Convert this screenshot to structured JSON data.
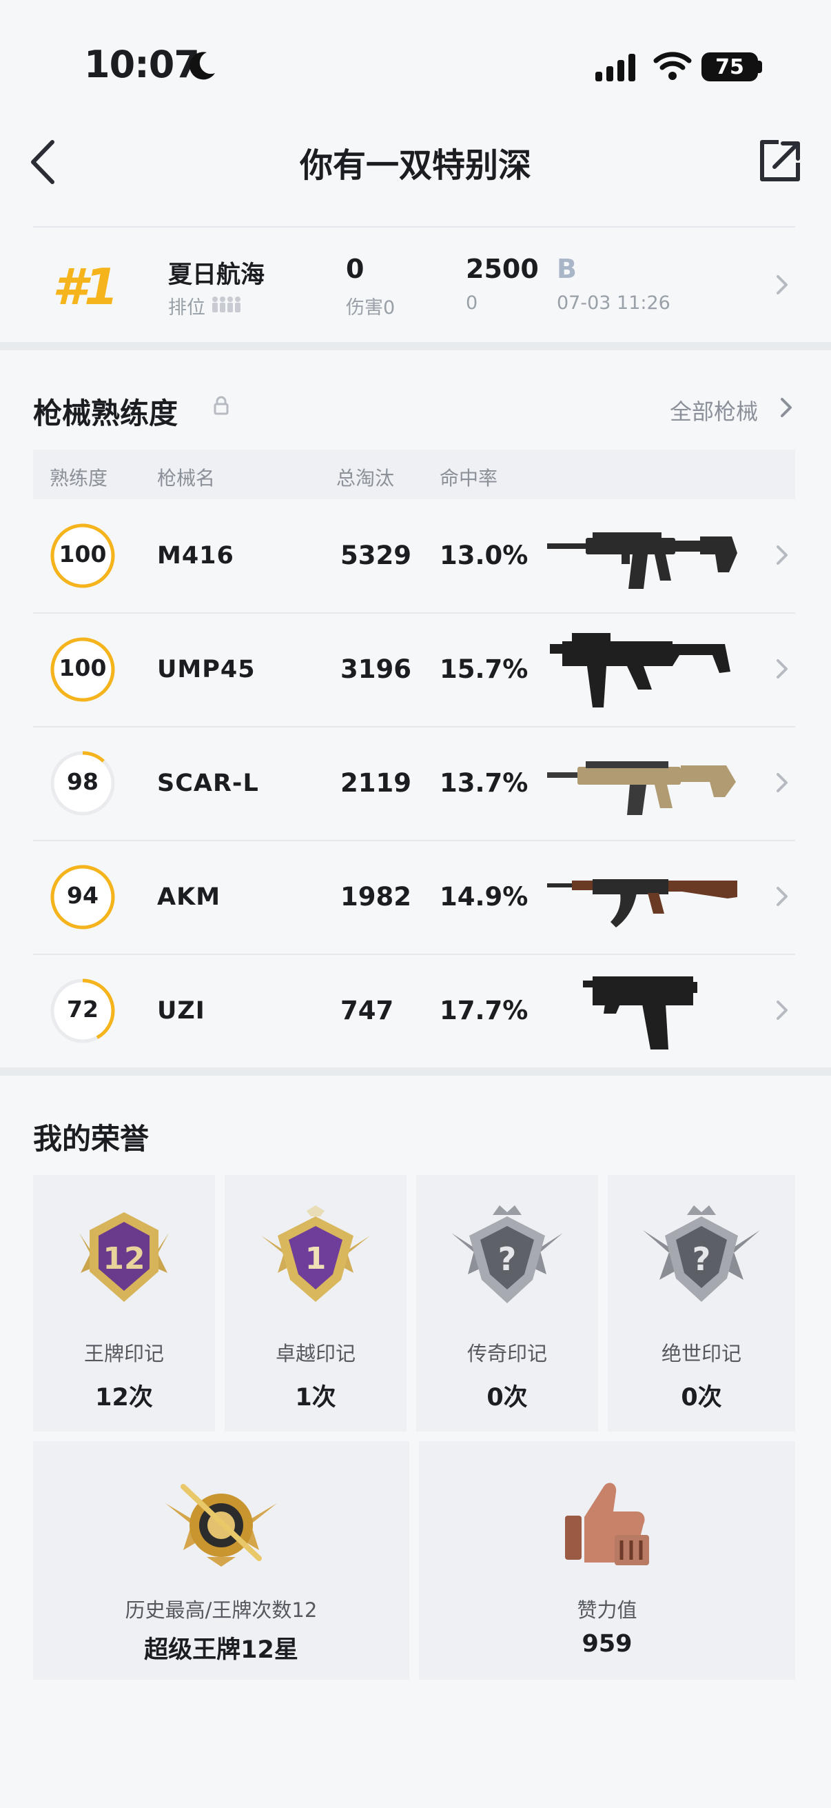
{
  "status_bar": {
    "time": "10:07",
    "battery": "75"
  },
  "header": {
    "title": "你有一双特别深"
  },
  "match": {
    "rank": "#1",
    "map": "夏日航海",
    "rank_label": "排位",
    "kills": "0",
    "damage_label": "伤害0",
    "score": "2500",
    "score_sub": "0",
    "mode_letter": "B",
    "time": "07-03 11:26"
  },
  "weapons": {
    "title": "枪械熟练度",
    "all_label": "全部枪械",
    "columns": [
      "熟练度",
      "枪械名",
      "总淘汰",
      "命中率"
    ],
    "rows": [
      {
        "level": "100",
        "progress": 1.0,
        "name": "M416",
        "kills": "5329",
        "accuracy": "13.0%"
      },
      {
        "level": "100",
        "progress": 1.0,
        "name": "UMP45",
        "kills": "3196",
        "accuracy": "15.7%"
      },
      {
        "level": "98",
        "progress": 0.12,
        "name": "SCAR-L",
        "kills": "2119",
        "accuracy": "13.7%"
      },
      {
        "level": "94",
        "progress": 1.0,
        "name": "AKM",
        "kills": "1982",
        "accuracy": "14.9%"
      },
      {
        "level": "72",
        "progress": 0.42,
        "name": "UZI",
        "kills": "747",
        "accuracy": "17.7%"
      }
    ]
  },
  "honors": {
    "title": "我的荣誉",
    "badges": [
      {
        "label": "王牌印记",
        "count": "12次",
        "badge_text": "12",
        "icon": "ace-badge-icon"
      },
      {
        "label": "卓越印记",
        "count": "1次",
        "badge_text": "1",
        "icon": "excellence-badge-icon"
      },
      {
        "label": "传奇印记",
        "count": "0次",
        "badge_text": "?",
        "icon": "legend-badge-icon"
      },
      {
        "label": "绝世印记",
        "count": "0次",
        "badge_text": "?",
        "icon": "peerless-badge-icon"
      }
    ],
    "highest": {
      "label": "历史最高/王牌次数12",
      "value": "超级王牌12星"
    },
    "likes": {
      "label": "赞力值",
      "value": "959"
    }
  },
  "colors": {
    "accent_gold": "#f5b41c",
    "ring_track": "#e9ebee",
    "page_bg": "#f5f7f9"
  }
}
